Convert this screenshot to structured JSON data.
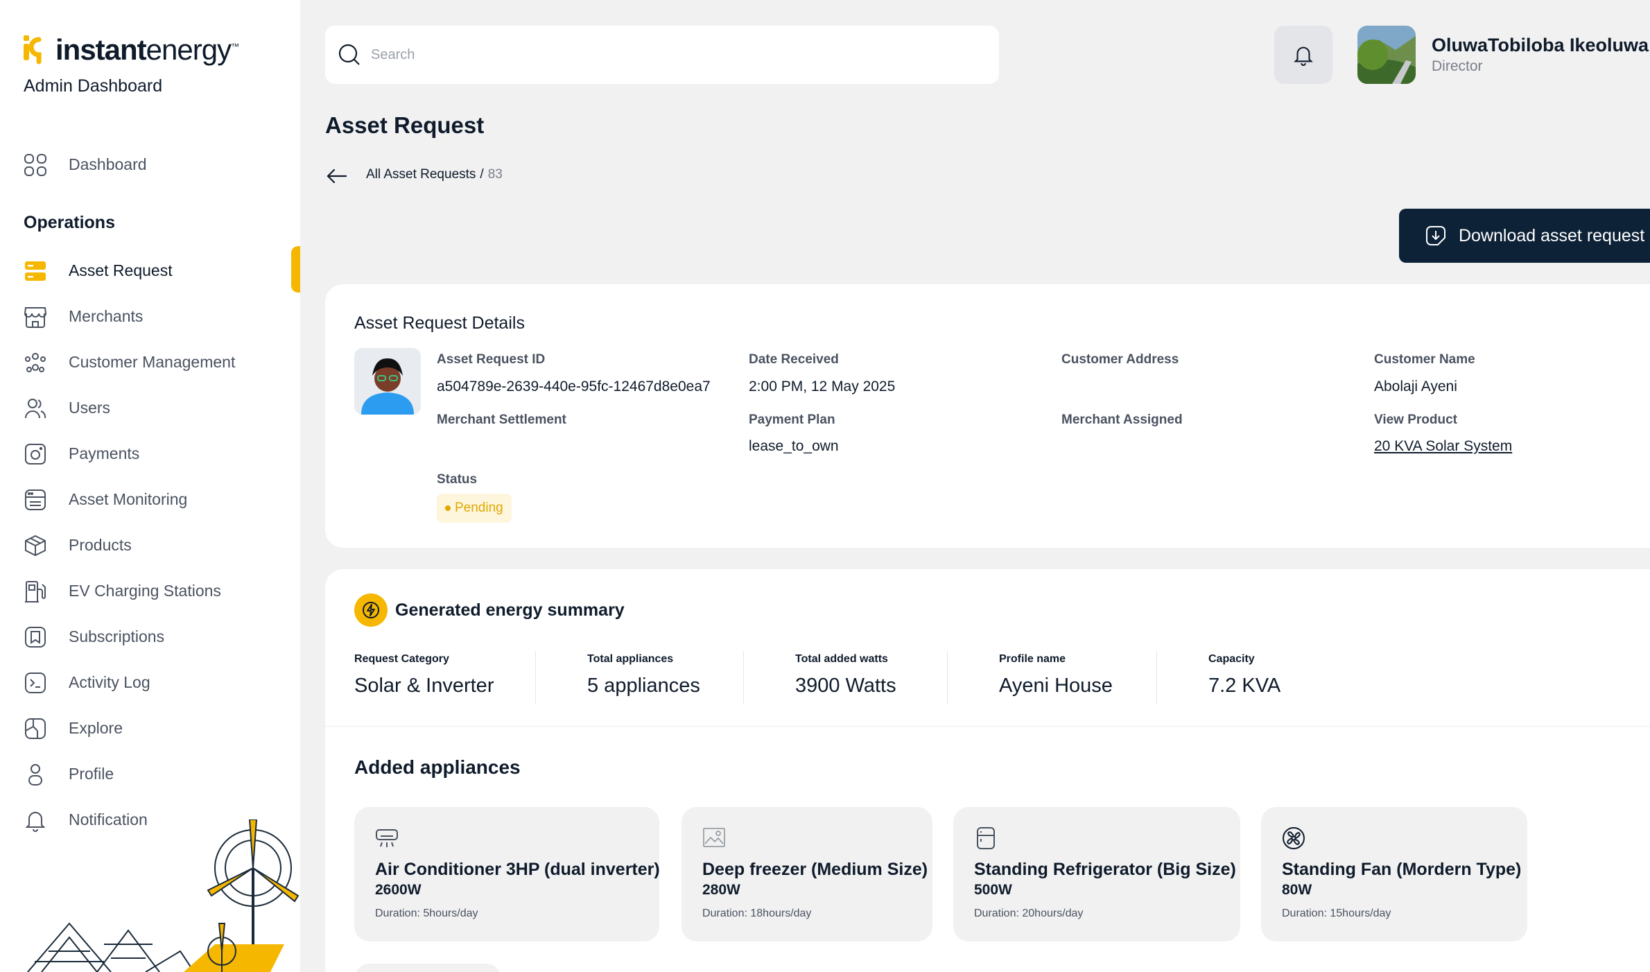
{
  "brand": {
    "logo_bold": "instant",
    "logo_light": "energy",
    "logo_tm": "™",
    "subtitle": "Admin Dashboard",
    "accent": "#f5b700",
    "navy": "#0d2137"
  },
  "sidebar": {
    "top_item": {
      "label": "Dashboard",
      "icon": "grid-icon"
    },
    "section_heading": "Operations",
    "items": [
      {
        "label": "Asset Request",
        "icon": "server-icon",
        "active": true
      },
      {
        "label": "Merchants",
        "icon": "store-icon"
      },
      {
        "label": "Customer Management",
        "icon": "people-group-icon"
      },
      {
        "label": "Users",
        "icon": "users-icon"
      },
      {
        "label": "Payments",
        "icon": "camera-icon"
      },
      {
        "label": "Asset Monitoring",
        "icon": "monitor-list-icon"
      },
      {
        "label": "Products",
        "icon": "box-icon"
      },
      {
        "label": "EV Charging Stations",
        "icon": "fuel-pump-icon"
      },
      {
        "label": "Subscriptions",
        "icon": "subscription-icon"
      },
      {
        "label": "Activity Log",
        "icon": "terminal-icon"
      },
      {
        "label": "Explore",
        "icon": "compass-map-icon"
      },
      {
        "label": "Profile",
        "icon": "person-icon"
      },
      {
        "label": "Notification",
        "icon": "bell-icon"
      }
    ]
  },
  "header": {
    "search_placeholder": "Search",
    "user_name": "OluwaTobiloba Ikeoluwa",
    "user_role": "Director"
  },
  "page": {
    "title": "Asset Request",
    "breadcrumb_link": "All Asset Requests",
    "breadcrumb_sep": "/",
    "breadcrumb_id": "83",
    "download_label": "Download asset request"
  },
  "details": {
    "title": "Asset Request Details",
    "fields": {
      "asset_request_id_label": "Asset Request ID",
      "asset_request_id": "a504789e-2639-440e-95fc-12467d8e0ea7",
      "date_received_label": "Date Received",
      "date_received": "2:00 PM, 12 May 2025",
      "customer_address_label": "Customer Address",
      "customer_address": "",
      "customer_name_label": "Customer Name",
      "customer_name": "Abolaji Ayeni",
      "merchant_settlement_label": "Merchant Settlement",
      "merchant_settlement": "",
      "payment_plan_label": "Payment Plan",
      "payment_plan": "lease_to_own",
      "merchant_assigned_label": "Merchant Assigned",
      "merchant_assigned": "",
      "view_product_label": "View Product",
      "view_product": "20 KVA Solar System",
      "status_label": "Status",
      "status": "Pending"
    }
  },
  "summary": {
    "title": "Generated energy summary",
    "stats": [
      {
        "label": "Request Category",
        "value": "Solar & Inverter"
      },
      {
        "label": "Total appliances",
        "value": "5 appliances"
      },
      {
        "label": "Total added watts",
        "value": "3900 Watts"
      },
      {
        "label": "Profile name",
        "value": "Ayeni House"
      },
      {
        "label": "Capacity",
        "value": "7.2 KVA"
      }
    ],
    "appliances_title": "Added appliances",
    "appliances": [
      {
        "name": "Air Conditioner 3HP (dual inverter)",
        "watts": "2600W",
        "duration": "Duration: 5hours/day",
        "icon": "air-conditioner-icon"
      },
      {
        "name": "Deep freezer (Medium Size)",
        "watts": "280W",
        "duration": "Duration: 18hours/day",
        "icon": "broken-image-icon"
      },
      {
        "name": "Standing Refrigerator (Big Size)",
        "watts": "500W",
        "duration": "Duration: 20hours/day",
        "icon": "refrigerator-icon"
      },
      {
        "name": "Standing Fan (Mordern Type)",
        "watts": "80W",
        "duration": "Duration: 15hours/day",
        "icon": "fan-icon"
      }
    ]
  }
}
